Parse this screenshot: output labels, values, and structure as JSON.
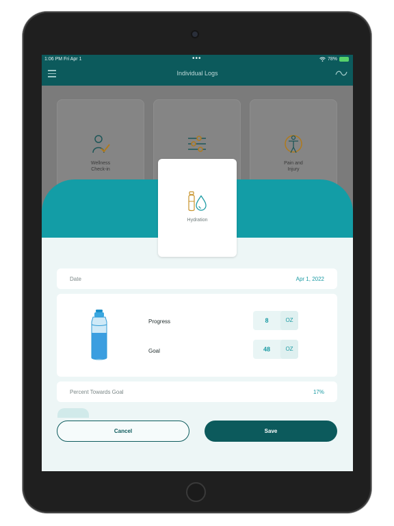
{
  "status_bar": {
    "time": "1:06 PM  Fri Apr 1",
    "battery": "78%"
  },
  "nav": {
    "title": "Individual Logs"
  },
  "tiles": [
    {
      "label_line1": "Wellness",
      "label_line2": "Check-in",
      "icon": "wellness-checkin-icon"
    },
    {
      "label_line1": "",
      "label_line2": "",
      "icon": "sliders-icon"
    },
    {
      "label_line1": "Pain and",
      "label_line2": "Injury",
      "icon": "body-pain-icon"
    }
  ],
  "modal": {
    "selected_card": {
      "label": "Hydration",
      "icon": "water-bottle-drop-icon"
    },
    "date": {
      "label": "Date",
      "value": "Apr 1, 2022"
    },
    "progress": {
      "label": "Progress",
      "value": "8",
      "unit": "OZ"
    },
    "goal": {
      "label": "Goal",
      "value": "48",
      "unit": "OZ"
    },
    "percent": {
      "label": "Percent Towards Goal",
      "value": "17%"
    },
    "bottle_fill_fraction": 0.17
  },
  "buttons": {
    "cancel": "Cancel",
    "save": "Save"
  },
  "colors": {
    "primary_dark": "#0c5a5c",
    "accent_teal": "#139da6",
    "background": "#edf6f6"
  }
}
